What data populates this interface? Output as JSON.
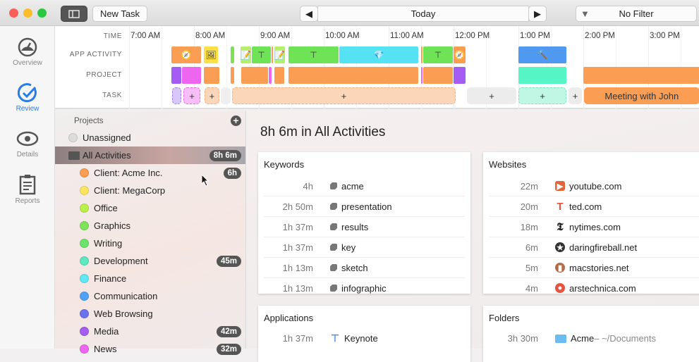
{
  "toolbar": {
    "new_task": "New Task",
    "date": "Today",
    "filter": "No Filter"
  },
  "nav": [
    {
      "label": "Overview"
    },
    {
      "label": "Review"
    },
    {
      "label": "Details"
    },
    {
      "label": "Reports"
    }
  ],
  "timeline": {
    "row_labels": [
      "TIME",
      "APP ACTIVITY",
      "PROJECT",
      "TASK"
    ],
    "ticks": [
      "7:00 AM",
      "8:00 AM",
      "9:00 AM",
      "10:00 AM",
      "11:00 AM",
      "12:00 PM",
      "1:00 PM",
      "2:00 PM",
      "3:00 PM"
    ],
    "app_activity": [
      {
        "start": 7.652,
        "end": 8.12,
        "color": "#fb9d52",
        "app": "safari"
      },
      {
        "start": 8.152,
        "end": 8.38,
        "color": "#fde047",
        "app": "preview"
      },
      {
        "start": 8.565,
        "end": 8.63,
        "color": "#7be34f",
        "app": ""
      },
      {
        "start": 8.717,
        "end": 8.89,
        "color": "#b5f06a",
        "app": "pages"
      },
      {
        "start": 8.89,
        "end": 9.196,
        "color": "#6ee356",
        "app": "keynote"
      },
      {
        "start": 9.196,
        "end": 9.228,
        "color": "#fb9d52",
        "app": ""
      },
      {
        "start": 9.239,
        "end": 9.413,
        "color": "#b5f06a",
        "app": "pages"
      },
      {
        "start": 9.457,
        "end": 10.239,
        "color": "#6ee356",
        "app": "keynote"
      },
      {
        "start": 10.239,
        "end": 11.467,
        "color": "#55e3f3",
        "app": "sketch"
      },
      {
        "start": 11.5,
        "end": 11.533,
        "color": "#fb9d52",
        "app": ""
      },
      {
        "start": 11.533,
        "end": 12.0,
        "color": "#6ee356",
        "app": "keynote"
      },
      {
        "start": 12.0,
        "end": 12.196,
        "color": "#fb9d52",
        "app": "safari"
      },
      {
        "start": 13.0,
        "end": 13.75,
        "color": "#4f9af0",
        "app": "xcode"
      }
    ],
    "project": [
      {
        "start": 7.652,
        "end": 7.815,
        "color": "#a55cf5"
      },
      {
        "start": 7.815,
        "end": 8.12,
        "color": "#ee66f0"
      },
      {
        "start": 8.152,
        "end": 8.4,
        "color": "#fb9d52"
      },
      {
        "start": 8.565,
        "end": 8.63,
        "color": "#fb9d52"
      },
      {
        "start": 8.728,
        "end": 9.152,
        "color": "#fb9d52"
      },
      {
        "start": 9.152,
        "end": 9.207,
        "color": "#ee66f0"
      },
      {
        "start": 9.239,
        "end": 9.4,
        "color": "#fb9d52"
      },
      {
        "start": 9.457,
        "end": 11.467,
        "color": "#fb9d52"
      },
      {
        "start": 11.5,
        "end": 11.533,
        "color": "#ee66f0"
      },
      {
        "start": 11.533,
        "end": 12.0,
        "color": "#fb9d52"
      },
      {
        "start": 12.0,
        "end": 12.196,
        "color": "#a55cf5"
      },
      {
        "start": 13.0,
        "end": 13.75,
        "color": "#56f5c6"
      },
      {
        "start": 14.0,
        "end": 15.8,
        "color": "#fb9d52"
      }
    ],
    "task": [
      {
        "start": 7.663,
        "end": 7.815,
        "color": "#d7c7fb",
        "border": "#a57cf0",
        "label": ""
      },
      {
        "start": 7.837,
        "end": 8.109,
        "color": "#f6bdf6",
        "border": "#e06ce6",
        "label": "+"
      },
      {
        "start": 8.163,
        "end": 8.4,
        "color": "#fbd6b8",
        "border": "#f3b282",
        "label": "+"
      },
      {
        "start": 8.413,
        "end": 8.576,
        "color": "#efefef",
        "border": "",
        "label": ""
      },
      {
        "start": 8.587,
        "end": 12.043,
        "color": "#fcd6b8",
        "border": "#f3b282",
        "label": "+"
      },
      {
        "start": 12.207,
        "end": 12.978,
        "color": "#ececec",
        "border": "",
        "label": "+"
      },
      {
        "start": 13.0,
        "end": 13.75,
        "color": "#bff6e4",
        "border": "#7de7c4",
        "label": "+"
      },
      {
        "start": 13.772,
        "end": 13.989,
        "color": "#ececec",
        "border": "",
        "label": "+"
      },
      {
        "start": 14.011,
        "end": 15.8,
        "color": "#fb9d52",
        "border": "",
        "label": "Meeting with John"
      }
    ]
  },
  "sidebar": {
    "header": "Projects",
    "items": [
      {
        "label": "Unassigned",
        "color": "#dcdcdc",
        "badge": ""
      },
      {
        "label": "All Activities",
        "color": "",
        "badge": "8h 6m"
      },
      {
        "label": "Client: Acme Inc.",
        "color": "#fb9d52",
        "badge": "6h"
      },
      {
        "label": "Client: MegaCorp",
        "color": "#fde560",
        "badge": ""
      },
      {
        "label": "Office",
        "color": "#b9f04a",
        "badge": ""
      },
      {
        "label": "Graphics",
        "color": "#7fe35a",
        "badge": ""
      },
      {
        "label": "Writing",
        "color": "#6ee36a",
        "badge": ""
      },
      {
        "label": "Development",
        "color": "#5ee8c0",
        "badge": "45m"
      },
      {
        "label": "Finance",
        "color": "#62e8f4",
        "badge": ""
      },
      {
        "label": "Communication",
        "color": "#4fa2f5",
        "badge": ""
      },
      {
        "label": "Web Browsing",
        "color": "#6a72ee",
        "badge": ""
      },
      {
        "label": "Media",
        "color": "#a55cf0",
        "badge": "42m"
      },
      {
        "label": "News",
        "color": "#ee66f0",
        "badge": "32m"
      }
    ]
  },
  "main": {
    "title": "8h 6m in All Activities",
    "keywords": {
      "title": "Keywords",
      "rows": [
        {
          "time": "4h",
          "label": "acme"
        },
        {
          "time": "2h 50m",
          "label": "presentation"
        },
        {
          "time": "1h 37m",
          "label": "results"
        },
        {
          "time": "1h 37m",
          "label": "key"
        },
        {
          "time": "1h 13m",
          "label": "sketch"
        },
        {
          "time": "1h 13m",
          "label": "infographic"
        }
      ]
    },
    "websites": {
      "title": "Websites",
      "rows": [
        {
          "time": "22m",
          "label": "youtube.com",
          "icon": "▶",
          "color": "#e0663a"
        },
        {
          "time": "20m",
          "label": "ted.com",
          "icon": "T",
          "color": "#e8533f"
        },
        {
          "time": "18m",
          "label": "nytimes.com",
          "icon": "𝕿",
          "color": "#222"
        },
        {
          "time": "6m",
          "label": "daringfireball.net",
          "icon": "★",
          "color": "#333"
        },
        {
          "time": "5m",
          "label": "macstories.net",
          "icon": "▮",
          "color": "#b56a48"
        },
        {
          "time": "4m",
          "label": "arstechnica.com",
          "icon": "●",
          "color": "#e8533f"
        }
      ]
    },
    "applications": {
      "title": "Applications",
      "rows": [
        {
          "time": "1h 37m",
          "label": "Keynote"
        }
      ]
    },
    "folders": {
      "title": "Folders",
      "rows": [
        {
          "time": "3h 30m",
          "label": "Acme",
          "path": " – ~/Documents"
        }
      ]
    }
  }
}
